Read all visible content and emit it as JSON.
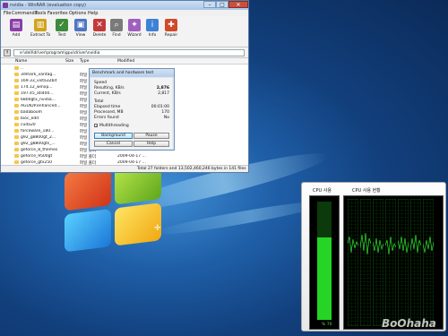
{
  "desktop": {
    "watermark": "BoOhaha"
  },
  "winrar": {
    "title": "nvidia - WinRAR (evaluation copy)",
    "menu": [
      "File",
      "Commands",
      "Tools",
      "Favorites",
      "Options",
      "Help"
    ],
    "toolbar": [
      "Add",
      "Extract To",
      "Test",
      "View",
      "Delete",
      "Find",
      "Wizard",
      "Info",
      "Repair"
    ],
    "toolbar_colors": [
      "#8a3ea8",
      "#d2a21e",
      "#3c8a3c",
      "#4f74c3",
      "#c23a3a",
      "#7a7a7a",
      "#a060c0",
      "#3d82d6",
      "#d04b2a"
    ],
    "path": "e:\\dell\\driver\\program\\gpu\\driver\\nvidia",
    "columns": [
      "Name",
      "Size",
      "Type",
      "Modified"
    ],
    "files": [
      {
        "name": "..",
        "size": "",
        "type": "",
        "modified": ""
      },
      {
        "name": "3dmark_vantag...",
        "size": "",
        "type": "파일 폴더",
        "modified": ""
      },
      {
        "name": "169.33_vista32bit",
        "size": "",
        "type": "파일 폴더",
        "modified": ""
      },
      {
        "name": "174.12_winxp...",
        "size": "",
        "type": "파일 폴더",
        "modified": ""
      },
      {
        "name": "197.45_ati400...",
        "size": "",
        "type": "파일 폴더",
        "modified": ""
      },
      {
        "name": "6800gtx_nvidia...",
        "size": "",
        "type": "파일 폴더",
        "modified": ""
      },
      {
        "name": "AGUIDP.enhanced...",
        "size": "",
        "type": "파일 폴더",
        "modified": ""
      },
      {
        "name": "badaboom",
        "size": "",
        "type": "파일 폴더",
        "modified": ""
      },
      {
        "name": "bioc_edit",
        "size": "",
        "type": "파일 폴더",
        "modified": ""
      },
      {
        "name": "cuda20",
        "size": "",
        "type": "파일 폴더",
        "modified": ""
      },
      {
        "name": "forceware_180...",
        "size": "",
        "type": "파일 폴더",
        "modified": ""
      },
      {
        "name": "g92_g8800gt_2...",
        "size": "",
        "type": "파일 폴더",
        "modified": ""
      },
      {
        "name": "g92_g8800gts_...",
        "size": "",
        "type": "파일 폴더",
        "modified": ""
      },
      {
        "name": "geforce_8_themes",
        "size": "",
        "type": "파일 폴더",
        "modified": "2009-04-17 ..."
      },
      {
        "name": "geforce_9500gt",
        "size": "",
        "type": "파일 폴더",
        "modified": "2009-04-17 ..."
      },
      {
        "name": "geforce_gtx250",
        "size": "",
        "type": "파일 폴더",
        "modified": "2009-04-17 ..."
      }
    ],
    "status": "Total 27 folders and 13,502,460,246 bytes in 141 files"
  },
  "dialog": {
    "title": "Benchmark and hardware test",
    "labels": {
      "speed": "Speed",
      "resulting": "Resulting, KB/s",
      "current": "Current, KB/s",
      "total": "Total",
      "elapsed": "Elapsed time",
      "processed": "Processed, MB",
      "errors": "Errors found"
    },
    "values": {
      "resulting": "2,876",
      "current": "2,817",
      "elapsed": "00:01:00",
      "processed": "170",
      "errors": "No"
    },
    "multithreading": "Multithreading",
    "multithreading_checked": true,
    "buttons": {
      "background": "Background",
      "pause": "Pause",
      "cancel": "Cancel",
      "help": "Help"
    }
  },
  "cpu_gadget": {
    "usage_label": "CPU 사용",
    "history_label": "CPU 사용 현황",
    "usage_percent": 70,
    "usage_text": "% 70"
  }
}
